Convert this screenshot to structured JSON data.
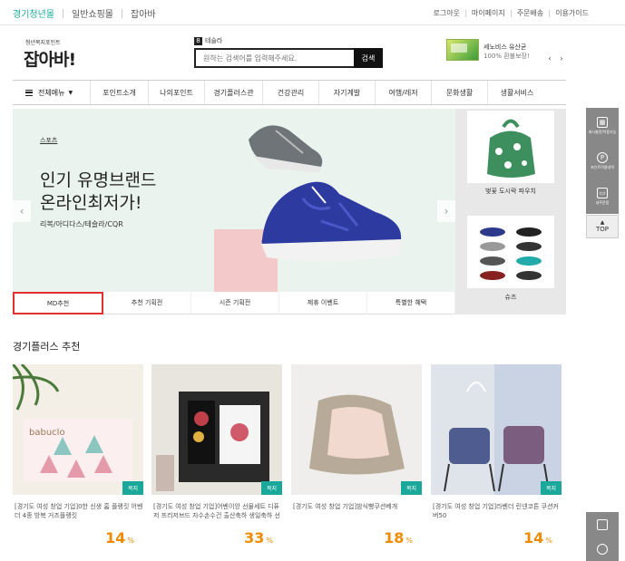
{
  "topbar": {
    "left": [
      "경기청년몰",
      "일반쇼핑몰",
      "잡아바"
    ],
    "right": [
      "로그아웃",
      "마이페이지",
      "주문배송",
      "이용가이드"
    ]
  },
  "header": {
    "logo_sub": "청년복지포인트",
    "logo_main": "잡아바!",
    "search_badge_num": "8",
    "search_badge_text": "테슬라",
    "search_placeholder": "원하는 검색어를 입력해주세요.",
    "search_button": "검색",
    "promo_title": "세노비스 유산균",
    "promo_sub": "100% 환불보장!"
  },
  "nav": {
    "all_menu": "전체메뉴",
    "items": [
      "포인트소개",
      "나의포인트",
      "경기플러스관",
      "건강관리",
      "자기계발",
      "여행/레저",
      "문화생활",
      "생활서비스"
    ]
  },
  "hero": {
    "category": "스포츠",
    "title_line1": "인기 유명브랜드",
    "title_line2": "온라인최저가!",
    "subtitle": "리복/아디다스/테슬라/CQR"
  },
  "tabs": [
    "MD추천",
    "추천 기획전",
    "시즌 기획전",
    "제휴 이벤트",
    "특별한 혜택"
  ],
  "side_products": [
    {
      "label": "벚꽃 도시락 파우치"
    },
    {
      "label": "슈즈"
    }
  ],
  "quick_bar": {
    "items": [
      "캐시충전/이용가능",
      "포인트이용내역",
      "내주문함"
    ],
    "top": "TOP"
  },
  "section": {
    "title": "경기플러스 추천",
    "products": [
      {
        "badge": "복지",
        "name": "[경기도 여성 창업 기업]0한 신생 홈 플랭킷 어벤더 4종 방복 거즈플랭킷",
        "discount": "14",
        "unit": "%"
      },
      {
        "badge": "복지",
        "name": "[경기도 여성 창업 기업]어벤이앙 선물세트 디퓨저 프리저브드 자수손수건 출산축하 생일축하 선물",
        "discount": "33",
        "unit": "%"
      },
      {
        "badge": "복지",
        "name": "[경기도 여성 창업 기업]밤식빵쿠션베개",
        "discount": "18",
        "unit": "%"
      },
      {
        "badge": "복지",
        "name": "[경기도 여성 창업 기업]라벤더 린넨코튼 쿠션커버50",
        "discount": "14",
        "unit": "%"
      }
    ]
  },
  "colors": {
    "accent": "#1aa89a",
    "discount": "#f08a00",
    "active_tab_border": "#e03030"
  }
}
